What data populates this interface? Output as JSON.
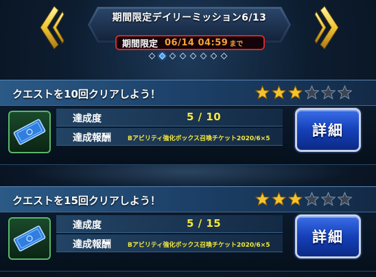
{
  "header": {
    "title": "期間限定デイリーミッション6/13",
    "deadline_label": "期間限定",
    "deadline_value": "06/14 04:59",
    "deadline_suffix": "まで",
    "page_count": 8,
    "active_page": 2
  },
  "labels": {
    "progress": "達成度",
    "reward": "達成報酬",
    "detail_button": "詳細"
  },
  "missions": [
    {
      "title": "クエストを10回クリアしよう！",
      "stars_filled": 3,
      "stars_total": 6,
      "progress": "5 / 10",
      "reward": "Bアビリティ強化ボックス召喚チケット2020/6×5"
    },
    {
      "title": "クエストを15回クリアしよう！",
      "stars_filled": 3,
      "stars_total": 6,
      "progress": "5 / 15",
      "reward": "Bアビリティ強化ボックス召喚チケット2020/6×5"
    }
  ],
  "colors": {
    "accent_gold": "#f6e93a",
    "deadline_orange": "#f7a23a",
    "deadline_border": "#d22a2a",
    "button_blue": "#1540b8",
    "active_dot": "#3a9cff"
  },
  "icons": {
    "prev": "chevron-left-icon",
    "next": "chevron-right-icon",
    "reward": "ticket-icon",
    "star_filled": "star-filled-icon",
    "star_empty": "star-empty-icon"
  }
}
